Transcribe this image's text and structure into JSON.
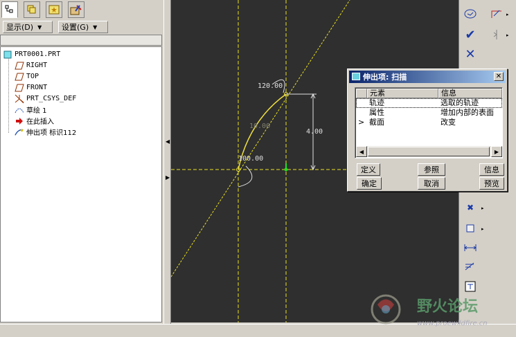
{
  "left_panel": {
    "tabs": [
      "model-tree-icon",
      "layers-icon",
      "folder-star-icon",
      "tools-icon"
    ],
    "menus": [
      {
        "label": "显示(D)"
      },
      {
        "label": "设置(G)"
      }
    ],
    "tree": [
      {
        "label": "PRT0001.PRT",
        "icon": "part-icon"
      },
      {
        "label": "RIGHT",
        "icon": "datum-plane-icon"
      },
      {
        "label": "TOP",
        "icon": "datum-plane-icon"
      },
      {
        "label": "FRONT",
        "icon": "datum-plane-icon"
      },
      {
        "label": "PRT_CSYS_DEF",
        "icon": "csys-icon"
      },
      {
        "label": "草绘 1",
        "icon": "sketch-icon"
      },
      {
        "label": "在此插入",
        "icon": "insert-here-icon"
      },
      {
        "label": "伸出项 标识112",
        "icon": "sweep-feature-icon"
      }
    ]
  },
  "canvas": {
    "dim_angle_top": "120.00",
    "dim_angle_bottom": "100.00",
    "dim_vertical": "4.00",
    "dim_radius": "10.00"
  },
  "dialog": {
    "title": "伸出项: 扫描",
    "columns": [
      "元素",
      "信息"
    ],
    "rows": [
      {
        "marker": "",
        "element": "轨迹",
        "info": "选取的轨迹"
      },
      {
        "marker": "",
        "element": "属性",
        "info": "增加内部的表面"
      },
      {
        "marker": ">",
        "element": "截面",
        "info": "改变"
      }
    ],
    "buttons": {
      "define": "定义",
      "reference": "参照",
      "info": "信息",
      "ok": "确定",
      "cancel": "取消",
      "preview": "预览"
    }
  },
  "watermark": {
    "title": "野火论坛",
    "url": "www.proewildfire.cn"
  },
  "colors": {
    "canvas_bg": "#2f2f2f",
    "sketch_yellow": "#e8e020",
    "dim_white": "#e0e0e0",
    "title_blue": "#0a246a"
  }
}
